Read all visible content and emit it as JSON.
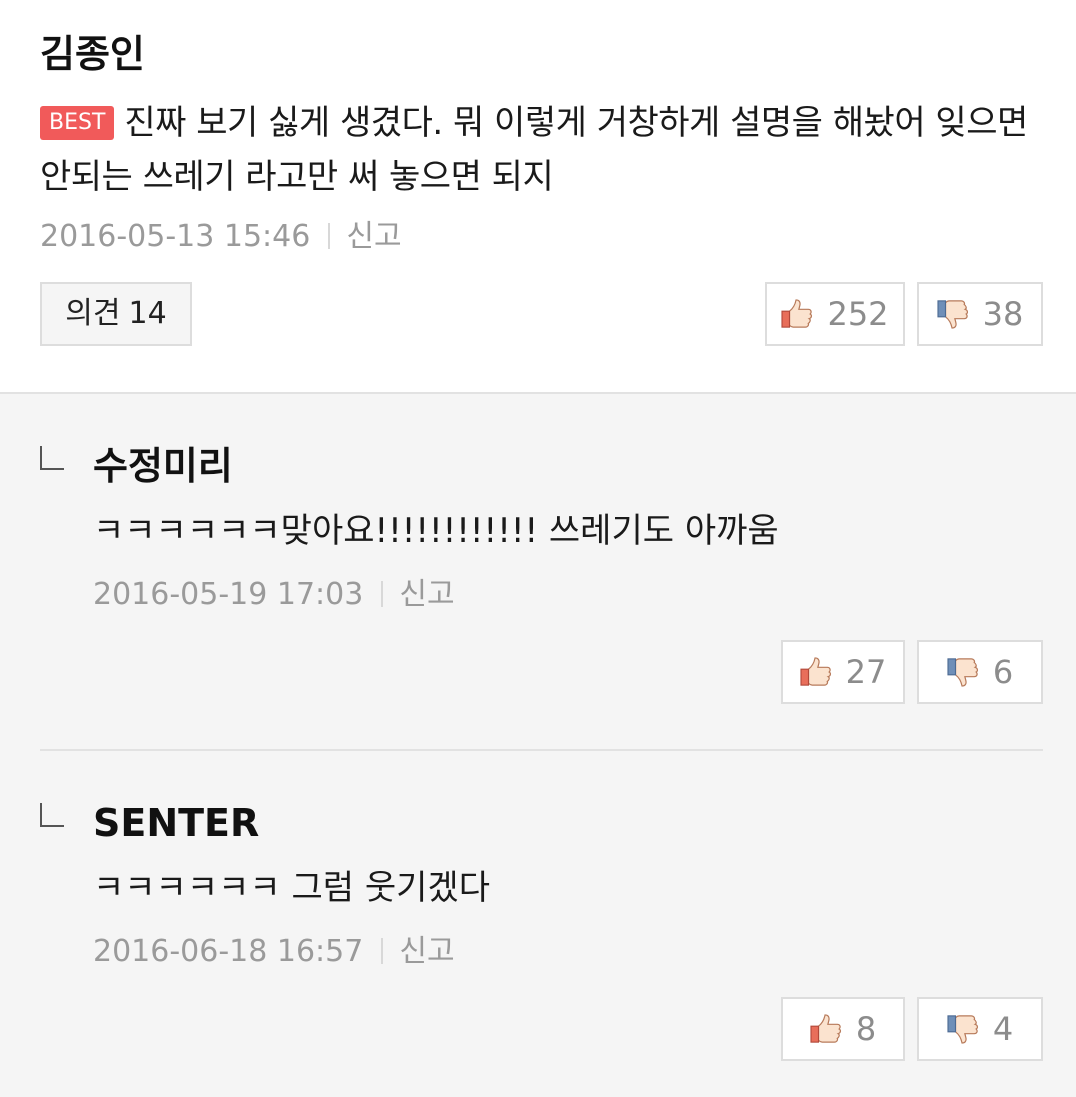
{
  "main_comment": {
    "author": "김종인",
    "badge": "BEST",
    "text": "진짜 보기 싫게 생겼다. 뭐 이렇게 거창하게 설명을 해놨어 잊으면 안되는 쓰레기 라고만 써 놓으면 되지",
    "date": "2016-05-13 15:46",
    "report_label": "신고",
    "opinion_label": "의견",
    "opinion_count": "14",
    "likes": "252",
    "dislikes": "38"
  },
  "replies": [
    {
      "author": "수정미리",
      "text": "ㅋㅋㅋㅋㅋㅋ맞아요!!!!!!!!!!!! 쓰레기도 아까움",
      "date": "2016-05-19 17:03",
      "report_label": "신고",
      "likes": "27",
      "dislikes": "6"
    },
    {
      "author": "SENTER",
      "text": "ㅋㅋㅋㅋㅋㅋ 그럼 웃기겠다",
      "date": "2016-06-18 16:57",
      "report_label": "신고",
      "likes": "8",
      "dislikes": "4"
    }
  ],
  "icons": {
    "like": "thumbs-up-icon",
    "dislike": "thumbs-down-icon",
    "reply": "reply-arrow-icon"
  },
  "colors": {
    "best_badge": "#f15a5a",
    "reply_background": "#f5f5f5",
    "meta_text": "#9a9a9a"
  }
}
